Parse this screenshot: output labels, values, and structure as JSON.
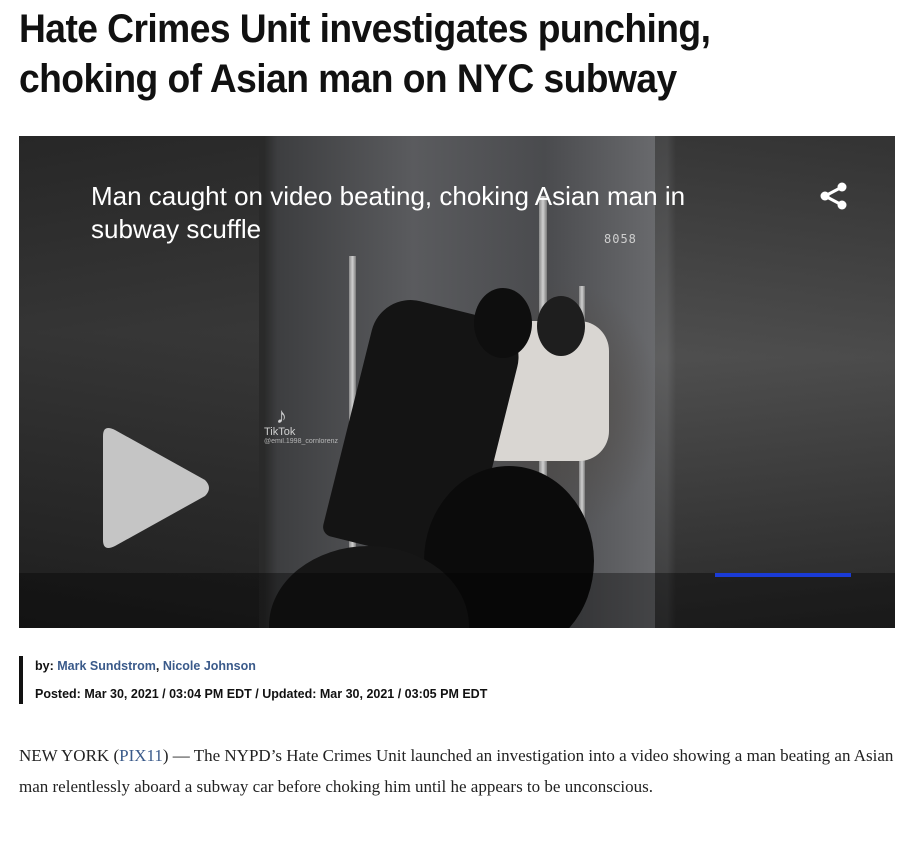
{
  "article": {
    "headline": "Hate Crimes Unit investigates punching, choking of Asian man on NYC subway",
    "video": {
      "title": "Man caught on video beating, choking Asian man in subway scuffle",
      "car_number": "8058",
      "watermark": "TikTok",
      "watermark_handle": "@emil.1998_cornlorenz",
      "progress_color": "#1a3bd6",
      "play_icon": "play-icon",
      "share_icon": "share-icon"
    },
    "byline": {
      "prefix": "by:",
      "authors": [
        "Mark Sundstrom",
        "Nicole Johnson"
      ],
      "separator": ",",
      "posted_label": "Posted:",
      "posted_value": "Mar 30, 2021 / 03:04 PM EDT",
      "divider": "/",
      "updated_label": "Updated:",
      "updated_value": "Mar 30, 2021 / 03:05 PM EDT"
    },
    "body": {
      "dateline": "NEW YORK (",
      "source_link": "PIX11",
      "lead_after_link": ") — The NYPD’s Hate Crimes Unit launched an investigation into a video showing a man beating an Asian man relentlessly aboard a subway car before choking him until he appears to be unconscious."
    }
  },
  "colors": {
    "link": "#3a5a8a",
    "headline": "#111111",
    "body": "#222222"
  }
}
